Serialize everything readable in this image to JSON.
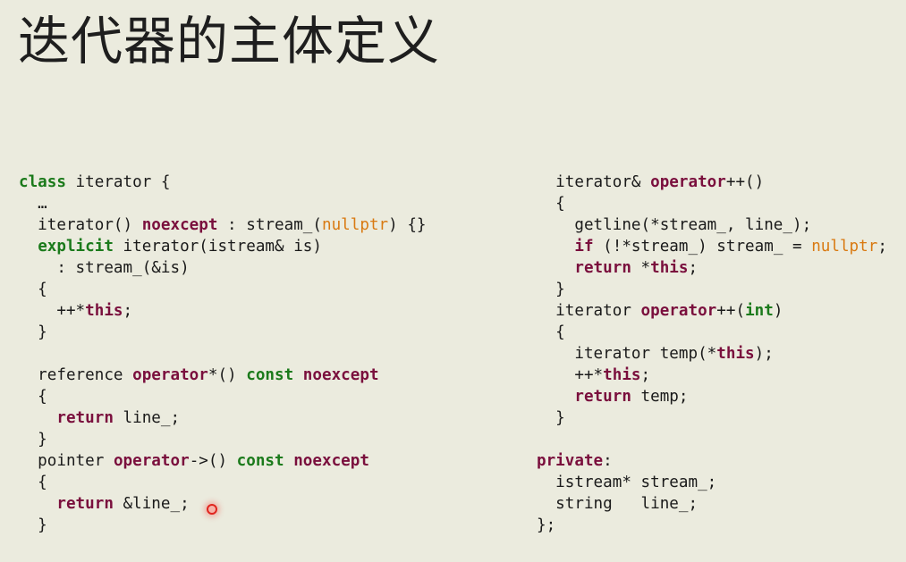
{
  "title": "迭代器的主体定义",
  "colors": {
    "background": "#ebebde",
    "keyword": "#7a0f3d",
    "type_keyword": "#1b7a1b",
    "literal": "#d97a12",
    "pointer": "#e0261f"
  },
  "left_code": [
    [
      [
        "grn",
        "class"
      ],
      [
        "txt",
        " iterator {"
      ]
    ],
    [
      [
        "txt",
        "  …"
      ]
    ],
    [
      [
        "txt",
        "  iterator() "
      ],
      [
        "kw",
        "noexcept"
      ],
      [
        "txt",
        " : stream_("
      ],
      [
        "org",
        "nullptr"
      ],
      [
        "txt",
        ") {}"
      ]
    ],
    [
      [
        "txt",
        "  "
      ],
      [
        "grn",
        "explicit"
      ],
      [
        "txt",
        " iterator(istream& is)"
      ]
    ],
    [
      [
        "txt",
        "    : stream_(&is)"
      ]
    ],
    [
      [
        "txt",
        "  {"
      ]
    ],
    [
      [
        "txt",
        "    ++*"
      ],
      [
        "kw",
        "this"
      ],
      [
        "txt",
        ";"
      ]
    ],
    [
      [
        "txt",
        "  }"
      ]
    ],
    [
      [
        "txt",
        ""
      ]
    ],
    [
      [
        "txt",
        "  reference "
      ],
      [
        "kw",
        "operator"
      ],
      [
        "txt",
        "*() "
      ],
      [
        "grn",
        "const"
      ],
      [
        "txt",
        " "
      ],
      [
        "kw",
        "noexcept"
      ]
    ],
    [
      [
        "txt",
        "  {"
      ]
    ],
    [
      [
        "txt",
        "    "
      ],
      [
        "kw",
        "return"
      ],
      [
        "txt",
        " line_;"
      ]
    ],
    [
      [
        "txt",
        "  }"
      ]
    ],
    [
      [
        "txt",
        "  pointer "
      ],
      [
        "kw",
        "operator"
      ],
      [
        "txt",
        "->() "
      ],
      [
        "grn",
        "const"
      ],
      [
        "txt",
        " "
      ],
      [
        "kw",
        "noexcept"
      ]
    ],
    [
      [
        "txt",
        "  {"
      ]
    ],
    [
      [
        "txt",
        "    "
      ],
      [
        "kw",
        "return"
      ],
      [
        "txt",
        " &line_;"
      ]
    ],
    [
      [
        "txt",
        "  }"
      ]
    ]
  ],
  "right_code": [
    [
      [
        "txt",
        "  iterator& "
      ],
      [
        "kw",
        "operator"
      ],
      [
        "txt",
        "++()"
      ]
    ],
    [
      [
        "txt",
        "  {"
      ]
    ],
    [
      [
        "txt",
        "    getline(*stream_, line_);"
      ]
    ],
    [
      [
        "txt",
        "    "
      ],
      [
        "kw",
        "if"
      ],
      [
        "txt",
        " (!*stream_) stream_ = "
      ],
      [
        "org",
        "nullptr"
      ],
      [
        "txt",
        ";"
      ]
    ],
    [
      [
        "txt",
        "    "
      ],
      [
        "kw",
        "return"
      ],
      [
        "txt",
        " *"
      ],
      [
        "kw",
        "this"
      ],
      [
        "txt",
        ";"
      ]
    ],
    [
      [
        "txt",
        "  }"
      ]
    ],
    [
      [
        "txt",
        "  iterator "
      ],
      [
        "kw",
        "operator"
      ],
      [
        "txt",
        "++("
      ],
      [
        "grn",
        "int"
      ],
      [
        "txt",
        ")"
      ]
    ],
    [
      [
        "txt",
        "  {"
      ]
    ],
    [
      [
        "txt",
        "    iterator temp(*"
      ],
      [
        "kw",
        "this"
      ],
      [
        "txt",
        ");"
      ]
    ],
    [
      [
        "txt",
        "    ++*"
      ],
      [
        "kw",
        "this"
      ],
      [
        "txt",
        ";"
      ]
    ],
    [
      [
        "txt",
        "    "
      ],
      [
        "kw",
        "return"
      ],
      [
        "txt",
        " temp;"
      ]
    ],
    [
      [
        "txt",
        "  }"
      ]
    ],
    [
      [
        "txt",
        ""
      ]
    ],
    [
      [
        "kw",
        "private"
      ],
      [
        "txt",
        ":"
      ]
    ],
    [
      [
        "txt",
        "  istream* stream_;"
      ]
    ],
    [
      [
        "txt",
        "  string   line_;"
      ]
    ],
    [
      [
        "txt",
        "};"
      ]
    ]
  ]
}
